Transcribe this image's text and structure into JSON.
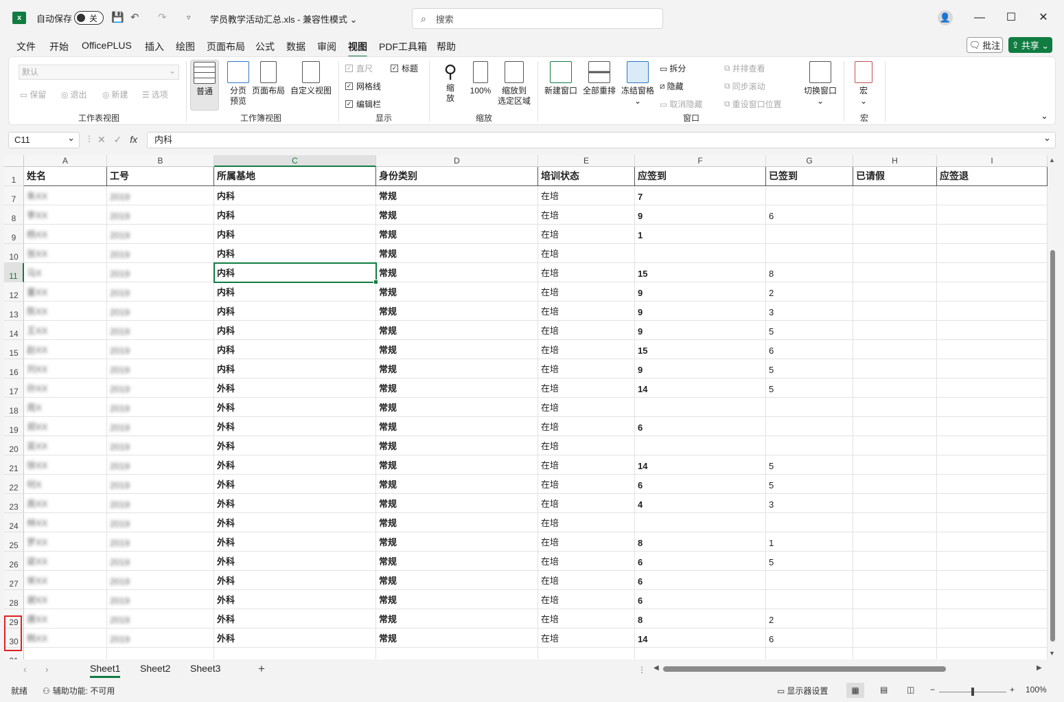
{
  "titlebar": {
    "autosave": "自动保存",
    "toggle_state": "关",
    "doc_title": "学员教学活动汇总.xls  -  兼容性模式 ⌄",
    "search_placeholder": "搜索"
  },
  "menu": [
    "文件",
    "开始",
    "OfficePLUS",
    "插入",
    "绘图",
    "页面布局",
    "公式",
    "数据",
    "审阅",
    "视图",
    "PDF工具箱",
    "帮助"
  ],
  "menu_active": "视图",
  "actions": {
    "comment": "批注",
    "share": "共享 ⌄"
  },
  "ribbon": {
    "sheetview": {
      "select_value": "默认",
      "keep": "保留",
      "exit": "退出",
      "new": "新建",
      "options": "选项",
      "label": "工作表视图"
    },
    "workbookview": {
      "normal": "普通",
      "pagebreak_1": "分页",
      "pagebreak_2": "预览",
      "pagelayout": "页面布局",
      "custom": "自定义视图",
      "label": "工作簿视图"
    },
    "show": {
      "ruler": "直尺",
      "gridlines": "网格线",
      "formulabar": "编辑栏",
      "headings": "标题",
      "label": "显示"
    },
    "zoom": {
      "zoom_1": "缩",
      "zoom_2": "放",
      "hundred": "100%",
      "to_sel_1": "缩放到",
      "to_sel_2": "选定区域",
      "label": "缩放"
    },
    "window": {
      "newwin": "新建窗口",
      "arrange": "全部重排",
      "freeze": "冻结窗格",
      "split": "拆分",
      "hide": "隐藏",
      "unhide": "取消隐藏",
      "side": "并排查看",
      "sync": "同步滚动",
      "reset": "重设窗口位置",
      "switch": "切换窗口",
      "label": "窗口"
    },
    "macro": {
      "btn": "宏",
      "label": "宏"
    }
  },
  "formula": {
    "namebox": "C11",
    "fx": "fx",
    "value": "内科"
  },
  "columns": [
    "A",
    "B",
    "C",
    "D",
    "E",
    "F",
    "G",
    "H",
    "I"
  ],
  "headers": [
    "姓名",
    "工号",
    "所属基地",
    "身份类别",
    "培训状态",
    "应签到",
    "已签到",
    "已请假",
    "应签退"
  ],
  "rows": [
    {
      "n": "7",
      "name": "朱XX",
      "id": "2019",
      "base": "内科",
      "type": "常规",
      "status": "在培",
      "due": "7",
      "done": ""
    },
    {
      "n": "8",
      "name": "李XX",
      "id": "2019",
      "base": "内科",
      "type": "常规",
      "status": "在培",
      "due": "9",
      "done": "6"
    },
    {
      "n": "9",
      "name": "杨XX",
      "id": "2019",
      "base": "内科",
      "type": "常规",
      "status": "在培",
      "due": "1",
      "done": ""
    },
    {
      "n": "10",
      "name": "张XX",
      "id": "2019",
      "base": "内科",
      "type": "常规",
      "status": "在培",
      "due": "",
      "done": ""
    },
    {
      "n": "11",
      "name": "马X",
      "id": "2019",
      "base": "内科",
      "type": "常规",
      "status": "在培",
      "due": "15",
      "done": "8"
    },
    {
      "n": "12",
      "name": "董XX",
      "id": "2019",
      "base": "内科",
      "type": "常规",
      "status": "在培",
      "due": "9",
      "done": "2"
    },
    {
      "n": "13",
      "name": "陈XX",
      "id": "2019",
      "base": "内科",
      "type": "常规",
      "status": "在培",
      "due": "9",
      "done": "3"
    },
    {
      "n": "14",
      "name": "王XX",
      "id": "2019",
      "base": "内科",
      "type": "常规",
      "status": "在培",
      "due": "9",
      "done": "5"
    },
    {
      "n": "15",
      "name": "赵XX",
      "id": "2019",
      "base": "内科",
      "type": "常规",
      "status": "在培",
      "due": "15",
      "done": "6"
    },
    {
      "n": "16",
      "name": "刘XX",
      "id": "2019",
      "base": "内科",
      "type": "常规",
      "status": "在培",
      "due": "9",
      "done": "5"
    },
    {
      "n": "17",
      "name": "孙XX",
      "id": "2019",
      "base": "外科",
      "type": "常规",
      "status": "在培",
      "due": "14",
      "done": "5"
    },
    {
      "n": "18",
      "name": "周X",
      "id": "2019",
      "base": "外科",
      "type": "常规",
      "status": "在培",
      "due": "",
      "done": ""
    },
    {
      "n": "19",
      "name": "郑XX",
      "id": "2019",
      "base": "外科",
      "type": "常规",
      "status": "在培",
      "due": "6",
      "done": ""
    },
    {
      "n": "20",
      "name": "吴XX",
      "id": "2019",
      "base": "外科",
      "type": "常规",
      "status": "在培",
      "due": "",
      "done": ""
    },
    {
      "n": "21",
      "name": "徐XX",
      "id": "2019",
      "base": "外科",
      "type": "常规",
      "status": "在培",
      "due": "14",
      "done": "5"
    },
    {
      "n": "22",
      "name": "何X",
      "id": "2019",
      "base": "外科",
      "type": "常规",
      "status": "在培",
      "due": "6",
      "done": "5"
    },
    {
      "n": "23",
      "name": "高XX",
      "id": "2019",
      "base": "外科",
      "type": "常规",
      "status": "在培",
      "due": "4",
      "done": "3"
    },
    {
      "n": "24",
      "name": "林XX",
      "id": "2019",
      "base": "外科",
      "type": "常规",
      "status": "在培",
      "due": "",
      "done": ""
    },
    {
      "n": "25",
      "name": "罗XX",
      "id": "2019",
      "base": "外科",
      "type": "常规",
      "status": "在培",
      "due": "8",
      "done": "1"
    },
    {
      "n": "26",
      "name": "梁XX",
      "id": "2019",
      "base": "外科",
      "type": "常规",
      "status": "在培",
      "due": "6",
      "done": "5"
    },
    {
      "n": "27",
      "name": "宋XX",
      "id": "2019",
      "base": "外科",
      "type": "常规",
      "status": "在培",
      "due": "6",
      "done": ""
    },
    {
      "n": "28",
      "name": "谢XX",
      "id": "2019",
      "base": "外科",
      "type": "常规",
      "status": "在培",
      "due": "6",
      "done": ""
    },
    {
      "n": "29",
      "name": "唐XX",
      "id": "2019",
      "base": "外科",
      "type": "常规",
      "status": "在培",
      "due": "8",
      "done": "2"
    },
    {
      "n": "30",
      "name": "韩XX",
      "id": "2019",
      "base": "外科",
      "type": "常规",
      "status": "在培",
      "due": "14",
      "done": "6"
    },
    {
      "n": "31",
      "name": "",
      "id": "",
      "base": "",
      "type": "",
      "status": "",
      "due": "",
      "done": ""
    }
  ],
  "sheets": [
    "Sheet1",
    "Sheet2",
    "Sheet3"
  ],
  "status": {
    "ready": "就绪",
    "accessibility": "辅助功能: 不可用",
    "display": "显示器设置",
    "zoom": "100%"
  }
}
